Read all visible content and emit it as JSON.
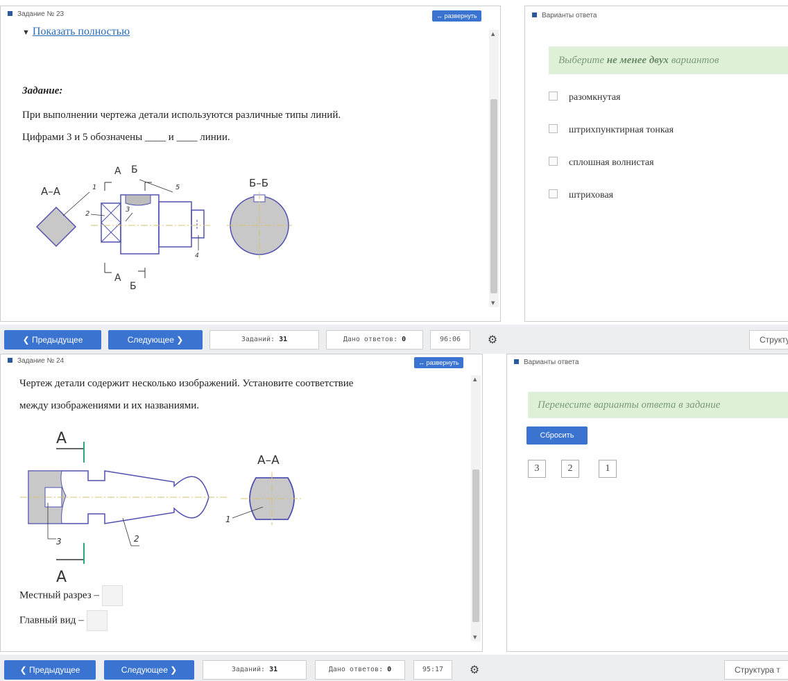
{
  "common": {
    "expand_label": "↔ развернуть"
  },
  "task1": {
    "title": "Задание № 23",
    "show_full": "Показать полностью",
    "heading": "Задание:",
    "line1": "При выполнении чертежа детали используются различные типы линий.",
    "line2": "Цифрами 3 и 5 обозначены ____ и ____ линии.",
    "figure": {
      "label_aa": "А–А",
      "label_bb": "Б–Б",
      "label_a": "А",
      "label_b": "Б",
      "n1": "1",
      "n2": "2",
      "n3": "3",
      "n4": "4",
      "n5": "5"
    }
  },
  "answers1": {
    "title": "Варианты ответа",
    "hint_pre": "Выберите ",
    "hint_bold": "не менее двух",
    "hint_post": " вариантов",
    "options": [
      "разомкнутая",
      "штрихпунктирная тонкая",
      "сплошная волнистая",
      "штриховая"
    ]
  },
  "bar1": {
    "prev": "❮ Предыдущее",
    "next": "Следующее ❯",
    "tasks_label": "Заданий:",
    "tasks_value": "31",
    "answers_label": "Дано ответов:",
    "answers_value": "0",
    "time": "96:06",
    "structure": "Структура"
  },
  "task2": {
    "title": "Задание № 24",
    "line1": "Чертеж детали содержит несколько изображений. Установите соответствие",
    "line2": "между изображениями и их названиями.",
    "figure": {
      "label_a_top": "А",
      "label_a_bottom": "А",
      "label_aa": "А–А",
      "n1": "1",
      "n2": "2",
      "n3": "3"
    },
    "match1": "Местный разрез –",
    "match2": "Главный вид –"
  },
  "answers2": {
    "title": "Варианты ответа",
    "hint": "Перенесите варианты ответа в задание",
    "reset": "Сбросить",
    "chips": [
      "3",
      "2",
      "1"
    ]
  },
  "bar2": {
    "prev": "❮ Предыдущее",
    "next": "Следующее ❯",
    "tasks_label": "Заданий:",
    "tasks_value": "31",
    "answers_label": "Дано ответов:",
    "answers_value": "0",
    "time": "95:17",
    "structure": "Структура т"
  }
}
